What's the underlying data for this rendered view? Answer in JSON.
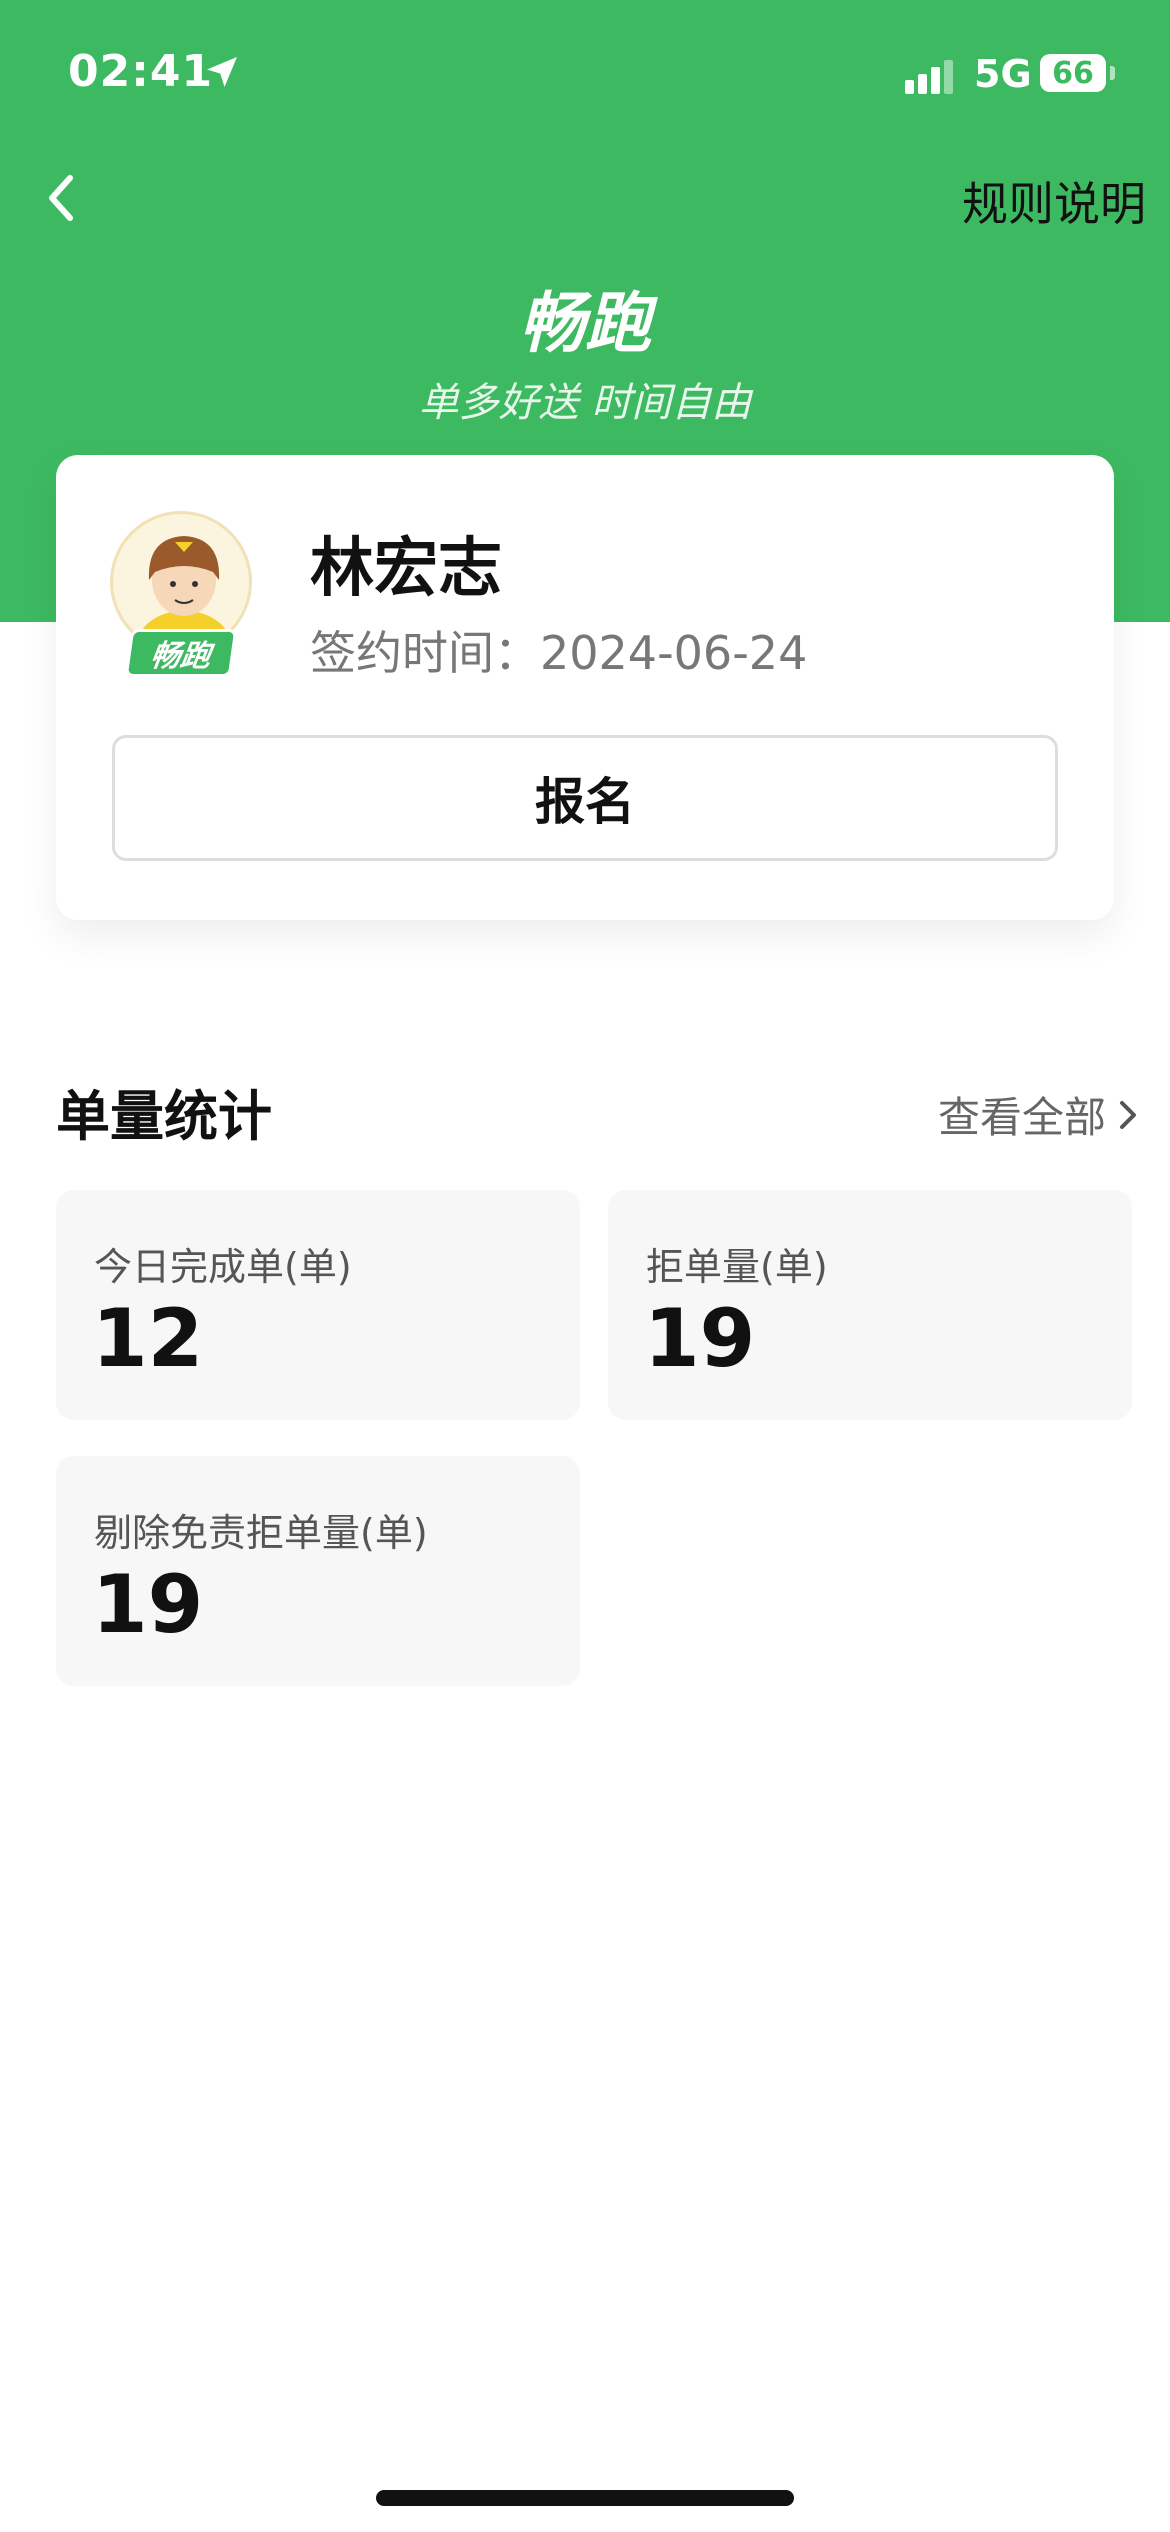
{
  "status_bar": {
    "time": "02:41",
    "network": "5G",
    "battery": "66",
    "location_icon": "location-arrow-icon",
    "signal_icon": "signal-bars-icon"
  },
  "nav": {
    "back_icon": "chevron-left-icon",
    "rules_label": "规则说明"
  },
  "brand": {
    "title": "畅跑",
    "slogan": "单多好送 时间自由",
    "color": "#3dba61"
  },
  "profile": {
    "name": "林宏志",
    "sign_label": "签约时间：",
    "sign_date": "2024-06-24",
    "badge": "畅跑",
    "signup_button": "报名"
  },
  "stats": {
    "title": "单量统计",
    "view_all": "查看全部",
    "items": [
      {
        "label": "今日完成单(单)",
        "value": "12"
      },
      {
        "label": "拒单量(单)",
        "value": "19"
      },
      {
        "label": "剔除免责拒单量(单)",
        "value": "19"
      }
    ]
  }
}
